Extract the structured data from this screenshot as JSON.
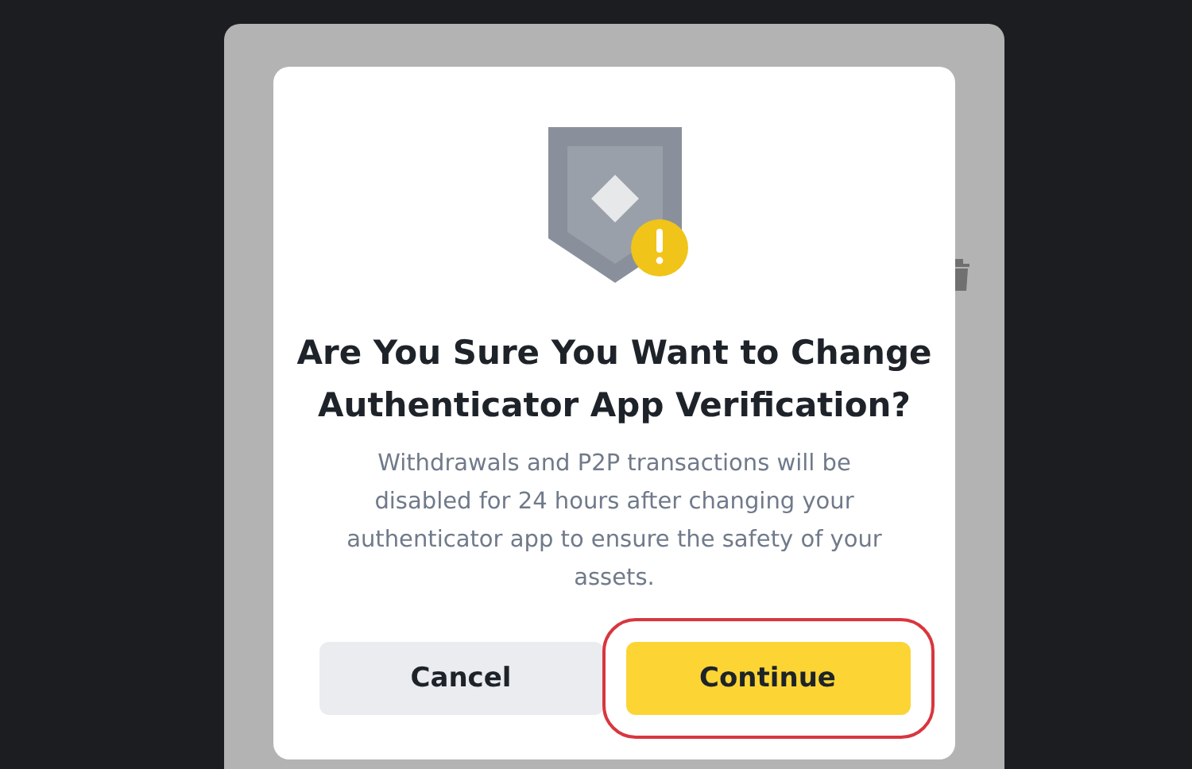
{
  "dialog": {
    "title": "Are You Sure You Want to Change Authenticator App Verification?",
    "message": "Withdrawals and P2P transactions will be disabled for 24 hours after changing your authenticator app to ensure the safety of your assets.",
    "buttons": [
      {
        "label": "Cancel",
        "kind": "secondary",
        "highlighted": false
      },
      {
        "label": "Continue",
        "kind": "primary",
        "highlighted": true
      }
    ]
  }
}
